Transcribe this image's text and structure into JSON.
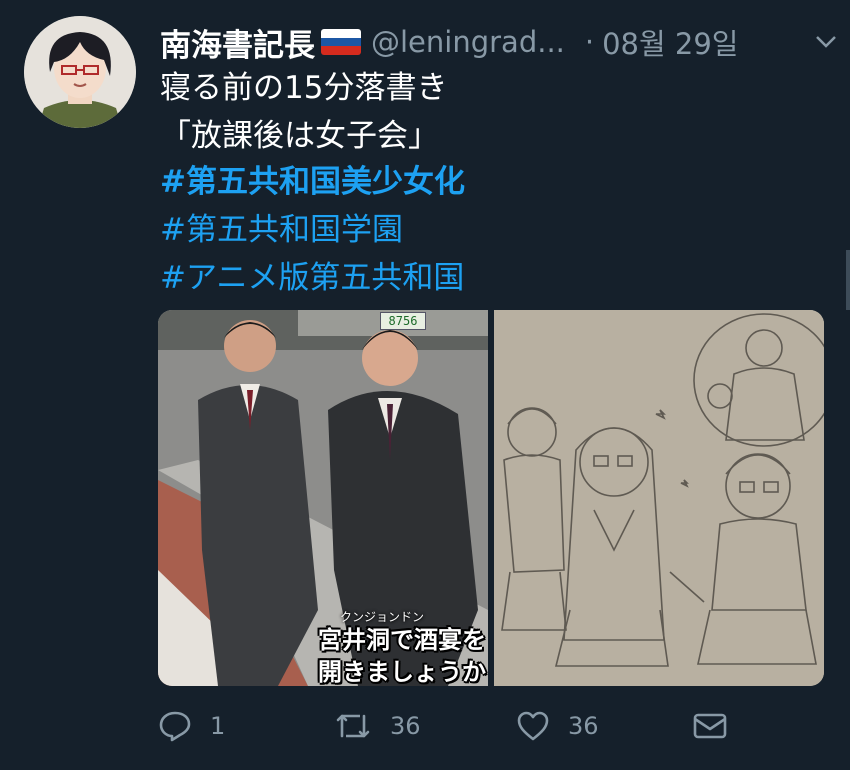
{
  "tweet": {
    "author_name": "南海書記長",
    "flag_icon": "russia-flag-icon",
    "handle": "@leningrad...",
    "separator": "·",
    "date": "08월 29일",
    "lines": [
      "寝る前の15分落書き",
      "「放課後は女子会」",
      "#第五共和国美少女化",
      "#第五共和国学園",
      "#アニメ版第五共和国"
    ]
  },
  "media": {
    "left": {
      "plate": "8756",
      "caption_small": "クンジョンドン",
      "caption_line1": "宮井洞で酒宴を",
      "caption_line2": "開きましょうか"
    }
  },
  "actions": {
    "reply_count": "1",
    "retweet_count": "36",
    "like_count": "36"
  },
  "colors": {
    "background": "#15202b",
    "text": "#ffffff",
    "secondary": "#8899a6",
    "hashtag": "#1da1f2"
  }
}
